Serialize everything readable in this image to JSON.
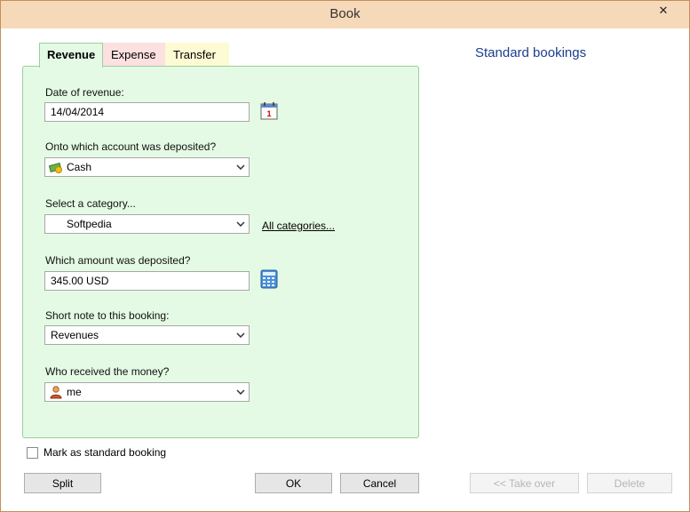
{
  "window": {
    "title": "Book",
    "close_symbol": "✕"
  },
  "tabs": [
    {
      "label": "Revenue",
      "active": true,
      "color": "#e4fae4"
    },
    {
      "label": "Expense",
      "active": false,
      "color": "#fde0e0"
    },
    {
      "label": "Transfer",
      "active": false,
      "color": "#fdfbd4"
    }
  ],
  "form": {
    "date_label": "Date of revenue:",
    "date_value": "14/04/2014",
    "account_label": "Onto which account was deposited?",
    "account_value": "Cash",
    "category_label": "Select a category...",
    "category_value": "Softpedia",
    "all_categories_link": "All categories...",
    "amount_label": "Which amount was deposited?",
    "amount_value": "345.00 USD",
    "note_label": "Short note to this booking:",
    "note_value": "Revenues",
    "receiver_label": "Who received the money?",
    "receiver_value": "me"
  },
  "right_panel": {
    "title": "Standard bookings"
  },
  "checkbox": {
    "label": "Mark as standard booking",
    "checked": false
  },
  "buttons": {
    "split": "Split",
    "ok": "OK",
    "cancel": "Cancel",
    "take_over": "<< Take over",
    "delete": "Delete"
  },
  "icons": {
    "calendar": "calendar-icon",
    "calculator": "calculator-icon",
    "cash": "cash-icon",
    "person": "person-icon",
    "chevron": "chevron-down-icon"
  },
  "colors": {
    "accent_title": "#1a3d8f",
    "titlebar": "#f6d9b9"
  }
}
